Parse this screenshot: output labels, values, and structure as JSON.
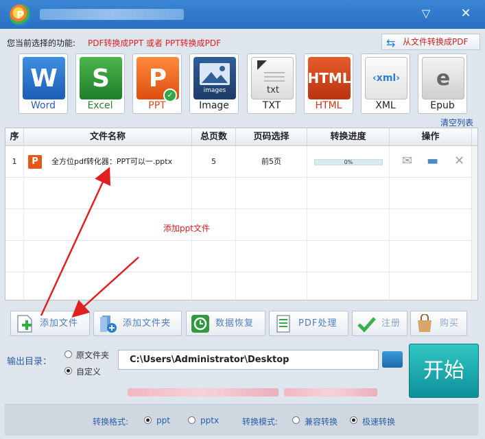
{
  "function_row": {
    "label": "您当前选择的功能:",
    "value": "PDF转换成PPT 或者 PPT转换成PDF",
    "from_file_button": "从文件转换成PDF"
  },
  "formats": [
    {
      "label": "Word",
      "glyph": "W"
    },
    {
      "label": "Excel",
      "glyph": "S"
    },
    {
      "label": "PPT",
      "glyph": "P"
    },
    {
      "label": "Image",
      "glyph": "images"
    },
    {
      "label": "TXT",
      "glyph": "txt"
    },
    {
      "label": "HTML",
      "glyph": "HTML"
    },
    {
      "label": "XML",
      "glyph": "‹xml›"
    },
    {
      "label": "Epub",
      "glyph": "e"
    }
  ],
  "clear_list": "清空列表",
  "table": {
    "headers": [
      "序",
      "文件名称",
      "总页数",
      "页码选择",
      "转换进度",
      "操作"
    ],
    "rows": [
      {
        "index": "1",
        "name": "全方位pdf转化器：PPT可以一.pptx",
        "pages": "5",
        "range": "前5页",
        "progress": "0%"
      }
    ]
  },
  "annotation": "添加ppt文件",
  "actions": {
    "add_file": "添加文件",
    "add_folder": "添加文件夹",
    "data_recovery": "数据恢复",
    "pdf_process": "PDF处理",
    "register": "注册",
    "buy": "购买"
  },
  "output": {
    "label": "输出目录：",
    "option_original": "原文件夹",
    "option_custom": "自定义",
    "path": "C:\\Users\\Administrator\\Desktop"
  },
  "start_button": "开始",
  "bottom": {
    "format_label": "转换格式:",
    "format_ppt": "ppt",
    "format_pptx": "pptx",
    "mode_label": "转换模式:",
    "mode_compatible": "兼容转换",
    "mode_fast": "极速转换"
  },
  "colors": {
    "title_bar": "#2b6fc0",
    "accent_red": "#e02020",
    "start_button": "#14a0a6"
  }
}
